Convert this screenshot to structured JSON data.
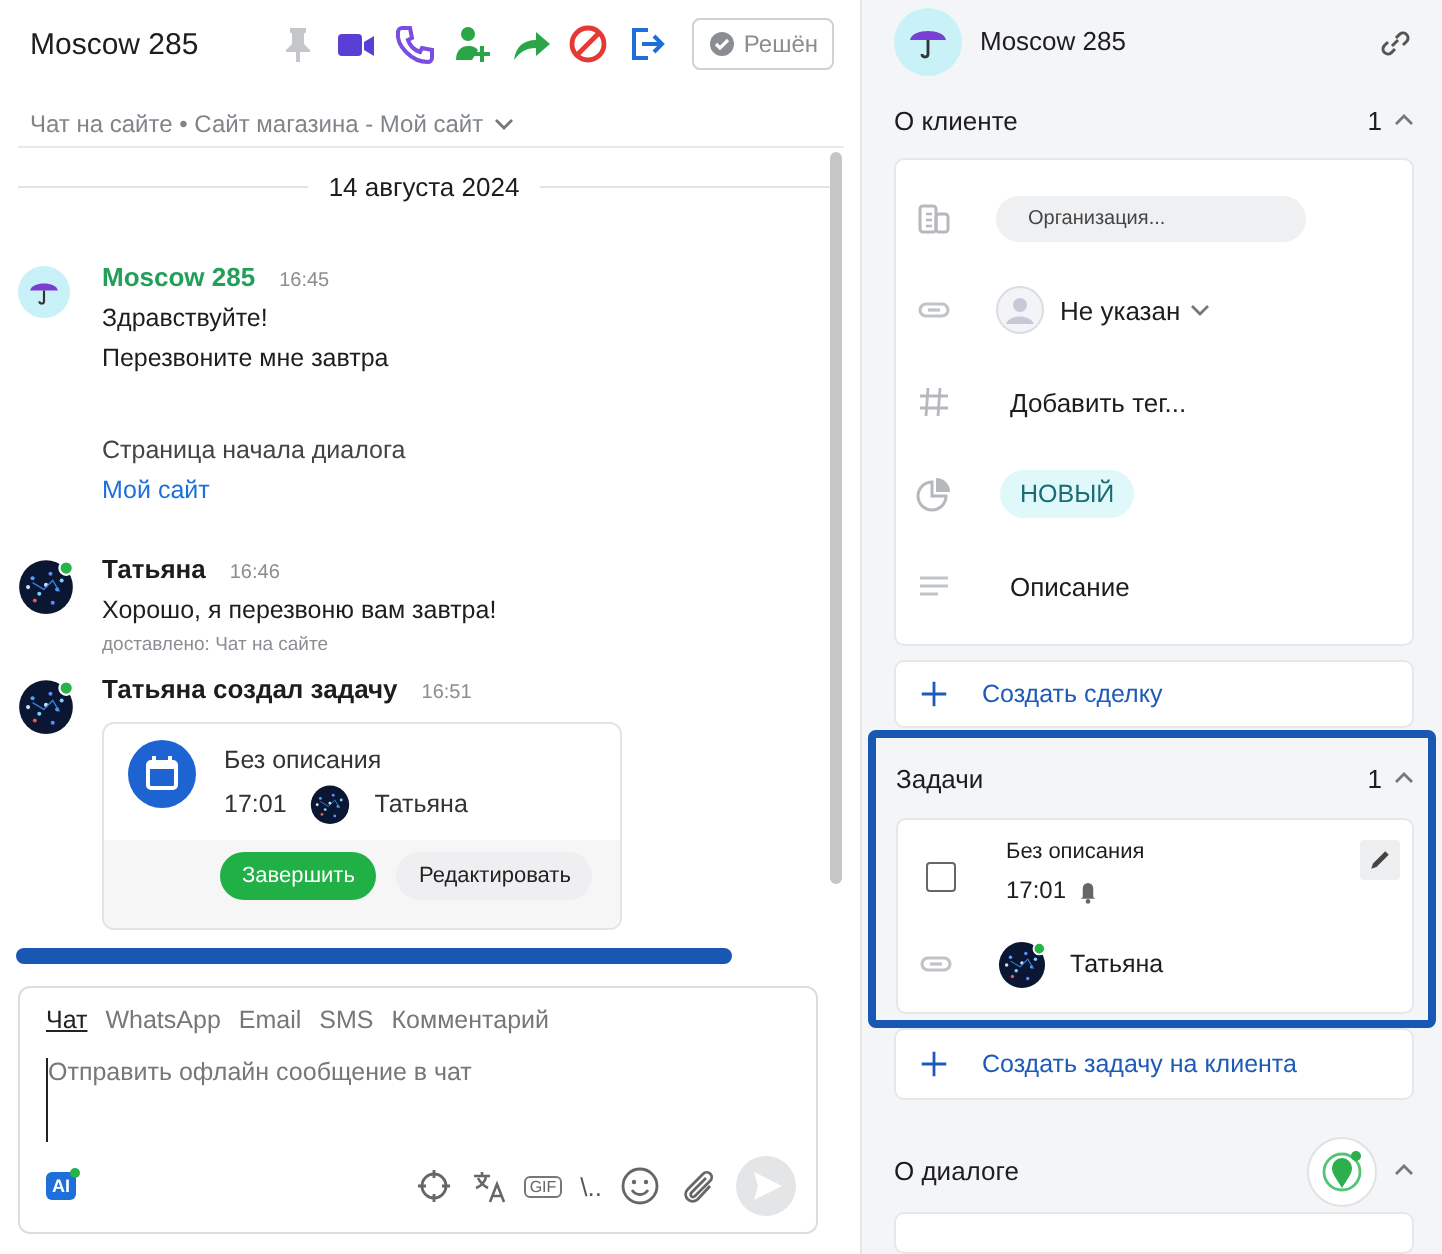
{
  "header": {
    "title": "Moscow 285",
    "resolve_button": "Решён"
  },
  "channel_path": "Чат на сайте • Сайт магазина - Мой сайт",
  "date_divider": "14 августа 2024",
  "messages": [
    {
      "kind": "client",
      "author": "Moscow 285",
      "time": "16:45",
      "lines": [
        "Здравствуйте!",
        "Перезвоните мне завтра"
      ],
      "page_label": "Страница начала диалога",
      "page_link": "Мой сайт"
    },
    {
      "kind": "agent",
      "author": "Татьяна",
      "time": "16:46",
      "online": true,
      "text": "Хорошо, я перезвоню вам завтра!",
      "delivery": "доставлено: Чат на сайте"
    },
    {
      "kind": "task_event",
      "author": "Татьяна создал задачу",
      "time": "16:51",
      "online": true,
      "task": {
        "title": "Без описания",
        "time": "17:01",
        "assignee": "Татьяна"
      },
      "buttons": [
        "Завершить",
        "Редактировать"
      ]
    }
  ],
  "composer": {
    "tabs": [
      {
        "label": "Чат",
        "selected": true
      },
      {
        "label": "WhatsApp",
        "selected": false
      },
      {
        "label": "Email",
        "selected": false
      },
      {
        "label": "SMS",
        "selected": false
      },
      {
        "label": "Комментарий",
        "selected": false
      }
    ],
    "placeholder": "Отправить офлайн сообщение в чат",
    "ai_badge": "AI",
    "gif": "GIF",
    "templates": "\\.."
  },
  "contact": {
    "name": "Moscow 285"
  },
  "client_section": {
    "title": "О клиенте",
    "count": "1",
    "expanded": true,
    "fields": [
      {
        "kind": "organization",
        "value": "Организация..."
      },
      {
        "kind": "responsible",
        "value": "Не указан"
      },
      {
        "kind": "tags",
        "value": "Добавить тег..."
      },
      {
        "kind": "status",
        "value": "НОВЫЙ"
      },
      {
        "kind": "description",
        "value": "Описание"
      }
    ],
    "action": "Создать сделку"
  },
  "tasks_section": {
    "title": "Задачи",
    "count": "1",
    "expanded": true,
    "highlighted": true,
    "tasks": [
      {
        "title": "Без описания",
        "time": "17:01",
        "checked": false,
        "assignee": "Татьяна",
        "online": true
      }
    ],
    "action": "Создать задачу на клиента"
  },
  "dialog_section": {
    "title": "О диалоге",
    "expanded": true
  }
}
